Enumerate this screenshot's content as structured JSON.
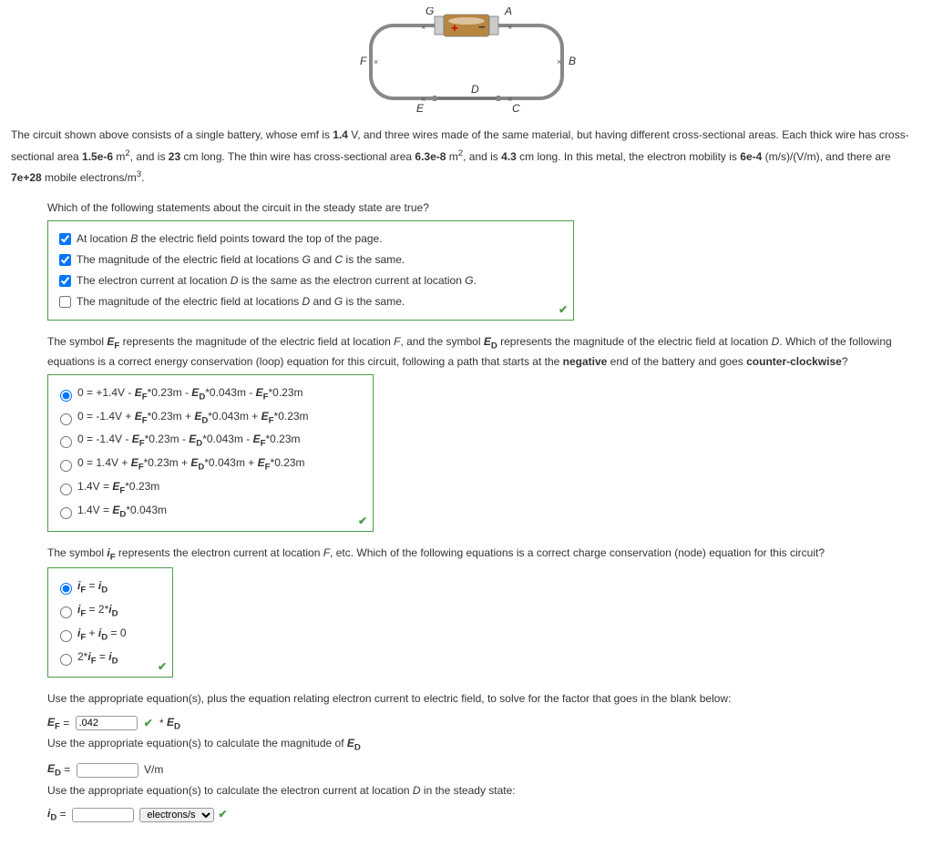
{
  "diagram": {
    "labels": {
      "G": "G",
      "A": "A",
      "F": "F",
      "B": "B",
      "E": "E",
      "D": "D",
      "C": "C",
      "plus": "+",
      "minus": "−",
      "x": "×"
    }
  },
  "intro": {
    "part1": "The circuit shown above consists of a single battery, whose emf is ",
    "emf": "1.4",
    "part2": " V, and three wires made of the same material, but having different cross-sectional areas. Each thick wire has cross-sectional area ",
    "area1": "1.5e-6",
    "part3": " m",
    "sq": "2",
    "part4": ", and is ",
    "len1": "23",
    "part5": " cm long. The thin wire has cross-sectional area ",
    "area2": "6.3e-8",
    "part6": " m",
    "part7": ", and is ",
    "len2": "4.3",
    "part8": " cm long. In this metal, the electron mobility is ",
    "mob": "6e-4",
    "part9": " (m/s)/(V/m), and there are ",
    "dens": "7e+28",
    "part10": " mobile electrons/m",
    "cube": "3",
    "part11": "."
  },
  "q1": {
    "prompt": "Which of the following statements about the circuit in the steady state are true?",
    "options": [
      {
        "pre": "At location ",
        "var": "B",
        "post": " the electric field points toward the top of the page.",
        "checked": true
      },
      {
        "pre": "The magnitude of the electric field at locations ",
        "var": "G",
        "mid": " and ",
        "var2": "C",
        "post": " is the same.",
        "checked": true
      },
      {
        "pre": "The electron current at location ",
        "var": "D",
        "mid": " is the same as the electron current at location ",
        "var2": "G",
        "post": ".",
        "checked": true
      },
      {
        "pre": "The magnitude of the electric field at locations ",
        "var": "D",
        "mid": " and ",
        "var2": "G",
        "post": " is the same.",
        "checked": false
      }
    ]
  },
  "q2": {
    "prompt_pre": "The symbol ",
    "ef": "E",
    "ef_sub": "F",
    "prompt_mid1": " represents the magnitude of the electric field at location ",
    "loc1": "F",
    "prompt_mid2": ", and the symbol ",
    "ed": "E",
    "ed_sub": "D",
    "prompt_mid3": " represents the magnitude of the electric field at location ",
    "loc2": "D",
    "prompt_mid4": ". Which of the following equations is a correct energy conservation (loop) equation for this circuit, following a path that starts at the ",
    "neg": "negative",
    "prompt_mid5": " end of the battery and goes ",
    "ccw": "counter-clockwise",
    "prompt_end": "?",
    "options": [
      "0 = +1.4V - E_F*0.23m - E_D*0.043m - E_F*0.23m",
      "0 = -1.4V + E_F*0.23m + E_D*0.043m + E_F*0.23m",
      "0 = -1.4V - E_F*0.23m - E_D*0.043m - E_F*0.23m",
      "0 = 1.4V + E_F*0.23m + E_D*0.043m + E_F*0.23m",
      "1.4V = E_F*0.23m",
      "1.4V = E_D*0.043m"
    ],
    "selected": 0
  },
  "q3": {
    "prompt_pre": "The symbol ",
    "if": "i",
    "if_sub": "F",
    "prompt_mid": " represents the electron current at location ",
    "loc": "F",
    "prompt_end": ", etc. Which of the following equations is a correct charge conservation (node) equation for this circuit?",
    "options": [
      "i_F = i_D",
      "i_F = 2*i_D",
      "i_F + i_D = 0",
      "2*i_F = i_D"
    ],
    "selected": 0
  },
  "calc": {
    "line1": "Use the appropriate equation(s), plus the equation relating electron current to electric field, to solve for the factor that goes in the blank below:",
    "ef": "E",
    "ef_sub": "F",
    "eq": " = ",
    "val1": ".042",
    "times": " * ",
    "ed": "E",
    "ed_sub": "D",
    "line2": "Use the appropriate equation(s) to calculate the magnitude of ",
    "unit_vm": "V/m",
    "line3": "Use the appropriate equation(s) to calculate the electron current at location ",
    "locD": "D",
    "line3_end": " in the steady state:",
    "id": "i",
    "id_sub": "D",
    "unit_sel": "electrons/s"
  }
}
